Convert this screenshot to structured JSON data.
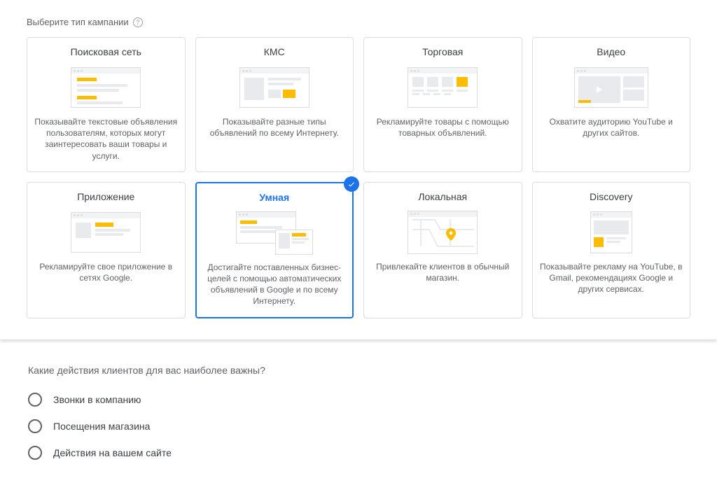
{
  "campaign_section": {
    "heading": "Выберите тип кампании",
    "cards": [
      {
        "title": "Поисковая сеть",
        "desc": "Показывайте текстовые объявления пользователям, которых могут заинтересовать ваши товары и услуги.",
        "selected": false
      },
      {
        "title": "КМС",
        "desc": "Показывайте разные типы объявлений по всему Интернету.",
        "selected": false
      },
      {
        "title": "Торговая",
        "desc": "Рекламируйте товары с помощью товарных объявлений.",
        "selected": false
      },
      {
        "title": "Видео",
        "desc": "Охватите аудиторию YouTube и других сайтов.",
        "selected": false
      },
      {
        "title": "Приложение",
        "desc": "Рекламируйте свое приложение в сетях Google.",
        "selected": false
      },
      {
        "title": "Умная",
        "desc": "Достигайте поставленных бизнес-целей с помощью автоматических объявлений в Google и по всему Интернету.",
        "selected": true
      },
      {
        "title": "Локальная",
        "desc": "Привлекайте клиентов в обычный магазин.",
        "selected": false
      },
      {
        "title": "Discovery",
        "desc": "Показывайте рекламу на YouTube, в Gmail, рекомендациях Google и других сервисах.",
        "selected": false
      }
    ]
  },
  "actions_section": {
    "heading": "Какие действия клиентов для вас наиболее важны?",
    "options": [
      {
        "label": "Звонки в компанию"
      },
      {
        "label": "Посещения магазина"
      },
      {
        "label": "Действия на вашем сайте"
      }
    ]
  }
}
